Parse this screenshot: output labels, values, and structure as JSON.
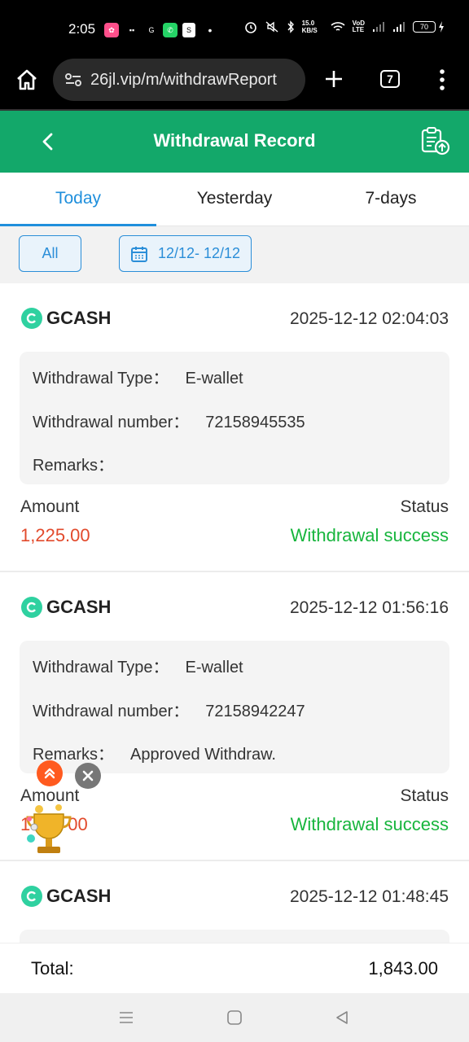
{
  "status_bar": {
    "time": "2:05",
    "net_speed": "15.0 KB/S",
    "battery": "70",
    "icons": [
      "temu-icon",
      "gcash-icon",
      "whatsapp-icon",
      "shopee-icon",
      "dot-icon",
      "alarm-icon",
      "mute-icon",
      "bluetooth-icon",
      "wifi-icon",
      "volte-icon",
      "signal-icon",
      "battery-icon",
      "charging-icon"
    ]
  },
  "browser": {
    "url": "26jl.vip/m/withdrawReport",
    "tab_count": "7",
    "icons": [
      "home-icon",
      "site-settings-icon",
      "new-tab-icon",
      "tabs-icon",
      "menu-icon"
    ]
  },
  "header": {
    "title": "Withdrawal Record",
    "back_icon": "chevron-left-icon",
    "action_icon": "clipboard-upload-icon",
    "color": "#13a86a"
  },
  "tabs": [
    {
      "label": "Today",
      "active": true
    },
    {
      "label": "Yesterday",
      "active": false
    },
    {
      "label": "7-days",
      "active": false
    }
  ],
  "filters": {
    "all_label": "All",
    "date_range": "12/12- 12/12",
    "date_icon": "calendar-icon"
  },
  "labels": {
    "withdrawal_type": "Withdrawal Type：",
    "withdrawal_number": "Withdrawal number：",
    "remarks": "Remarks：",
    "amount": "Amount",
    "status": "Status"
  },
  "records": [
    {
      "brand": "GCASH",
      "datetime": "2025-12-12 02:04:03",
      "type": "E-wallet",
      "number": "72158945535",
      "remarks": "",
      "amount": "1,225.00",
      "status": "Withdrawal success"
    },
    {
      "brand": "GCASH",
      "datetime": "2025-12-12 01:56:16",
      "type": "E-wallet",
      "number": "72158942247",
      "remarks": "Approved Withdraw.",
      "amount": "1",
      "amount_tail": "00",
      "status": "Withdrawal success"
    },
    {
      "brand": "GCASH",
      "datetime": "2025-12-12 01:48:45"
    }
  ],
  "total": {
    "label": "Total:",
    "value": "1,843.00"
  },
  "colors": {
    "accent_blue": "#1f8fdc",
    "amount_red": "#e24a2c",
    "success_green": "#17b53d"
  },
  "nav": [
    "recents-icon",
    "home-nav-icon",
    "back-nav-icon"
  ]
}
